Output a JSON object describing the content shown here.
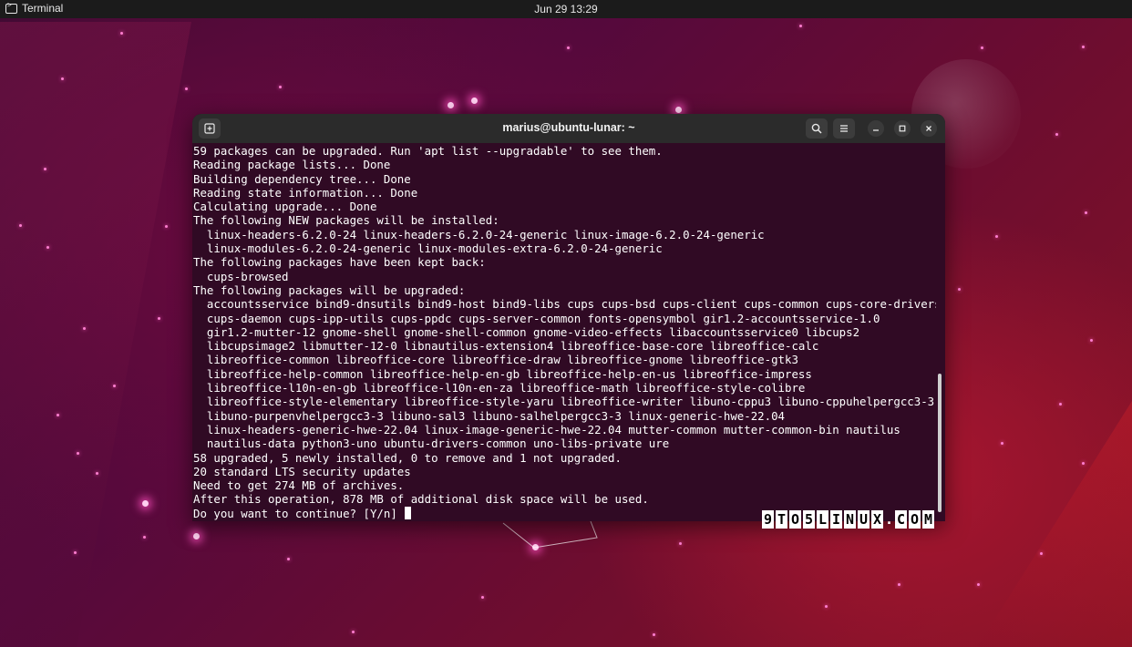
{
  "topbar": {
    "app_name": "Terminal",
    "clock": "Jun 29  13:29"
  },
  "window": {
    "title": "marius@ubuntu-lunar: ~",
    "icons": {
      "new_tab": "new-tab-icon",
      "search": "search-icon",
      "menu": "hamburger-menu-icon",
      "minimize": "minimize-icon",
      "maximize": "maximize-icon",
      "close": "close-icon"
    }
  },
  "terminal": {
    "lines": [
      "59 packages can be upgraded. Run 'apt list --upgradable' to see them.",
      "Reading package lists... Done",
      "Building dependency tree... Done",
      "Reading state information... Done",
      "Calculating upgrade... Done",
      "The following NEW packages will be installed:",
      "  linux-headers-6.2.0-24 linux-headers-6.2.0-24-generic linux-image-6.2.0-24-generic",
      "  linux-modules-6.2.0-24-generic linux-modules-extra-6.2.0-24-generic",
      "The following packages have been kept back:",
      "  cups-browsed",
      "The following packages will be upgraded:",
      "  accountsservice bind9-dnsutils bind9-host bind9-libs cups cups-bsd cups-client cups-common cups-core-drivers",
      "  cups-daemon cups-ipp-utils cups-ppdc cups-server-common fonts-opensymbol gir1.2-accountsservice-1.0",
      "  gir1.2-mutter-12 gnome-shell gnome-shell-common gnome-video-effects libaccountsservice0 libcups2",
      "  libcupsimage2 libmutter-12-0 libnautilus-extension4 libreoffice-base-core libreoffice-calc",
      "  libreoffice-common libreoffice-core libreoffice-draw libreoffice-gnome libreoffice-gtk3",
      "  libreoffice-help-common libreoffice-help-en-gb libreoffice-help-en-us libreoffice-impress",
      "  libreoffice-l10n-en-gb libreoffice-l10n-en-za libreoffice-math libreoffice-style-colibre",
      "  libreoffice-style-elementary libreoffice-style-yaru libreoffice-writer libuno-cppu3 libuno-cppuhelpergcc3-3",
      "  libuno-purpenvhelpergcc3-3 libuno-sal3 libuno-salhelpergcc3-3 linux-generic-hwe-22.04",
      "  linux-headers-generic-hwe-22.04 linux-image-generic-hwe-22.04 mutter-common mutter-common-bin nautilus",
      "  nautilus-data python3-uno ubuntu-drivers-common uno-libs-private ure",
      "58 upgraded, 5 newly installed, 0 to remove and 1 not upgraded.",
      "20 standard LTS security updates",
      "Need to get 274 MB of archives.",
      "After this operation, 878 MB of additional disk space will be used."
    ],
    "prompt": "Do you want to continue? [Y/n] "
  },
  "watermark": {
    "text": "9TO5LINUX.COM"
  },
  "colors": {
    "terminal_bg": "#300a24",
    "titlebar_bg": "#2b2b2b",
    "topbar_bg": "#1b1b1b"
  }
}
